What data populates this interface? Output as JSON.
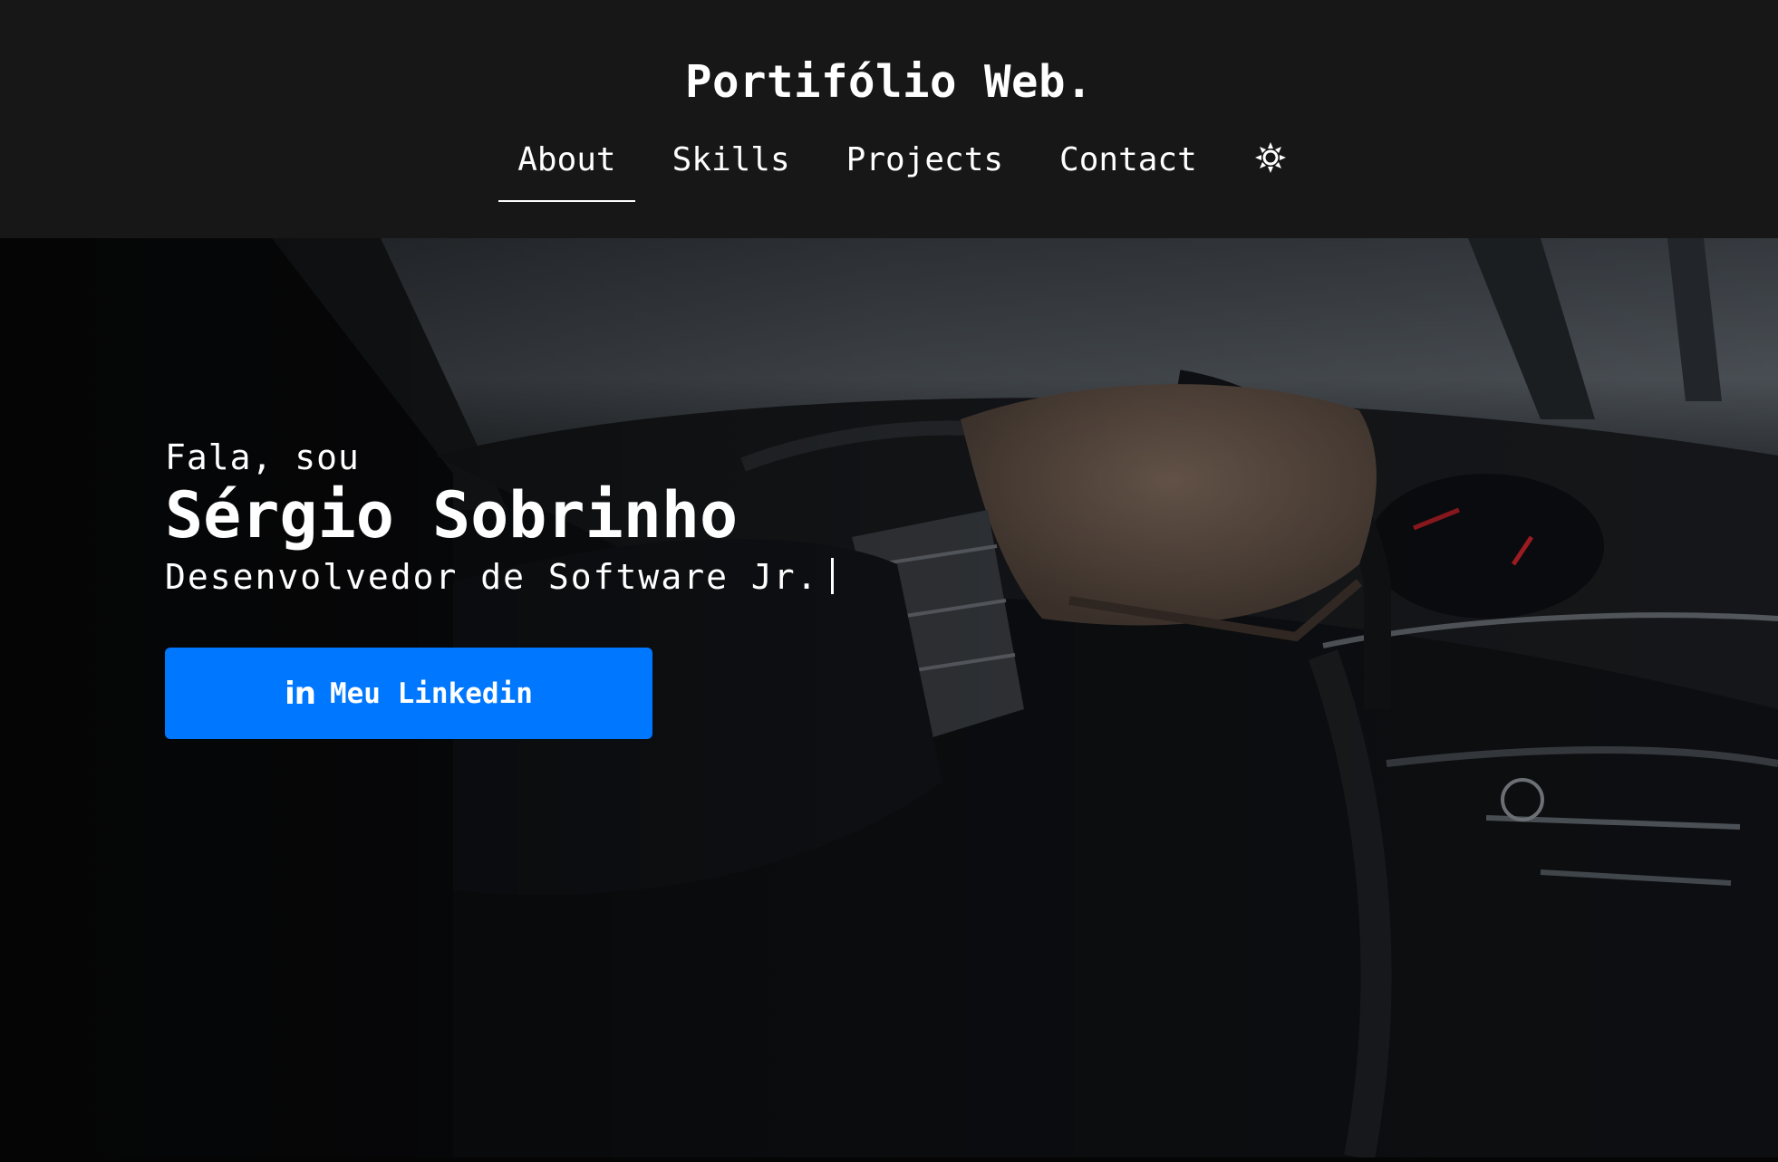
{
  "header": {
    "brand": "Portifólio Web.",
    "nav": [
      {
        "label": "About",
        "active": true
      },
      {
        "label": "Skills",
        "active": false
      },
      {
        "label": "Projects",
        "active": false
      },
      {
        "label": "Contact",
        "active": false
      }
    ],
    "theme_toggle_icon": "sun-icon"
  },
  "hero": {
    "greeting": "Fala, sou",
    "name": "Sérgio Sobrinho",
    "role": "Desenvolvedor de Software Jr.",
    "cta": {
      "icon": "linkedin-icon",
      "icon_text": "in",
      "label": "Meu Linkedin"
    },
    "background_image": "car-interior-hand-on-steering-wheel-photo"
  },
  "colors": {
    "page_background": "#171717",
    "text": "#ffffff",
    "accent": "#0077ff"
  }
}
